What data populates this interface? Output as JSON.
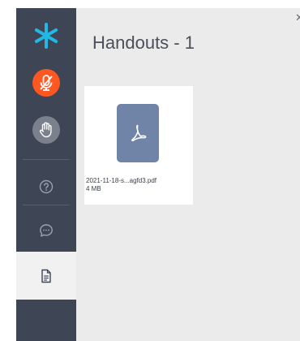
{
  "app": {
    "logo_icon": "asterisk-logo-icon",
    "accent_color": "#22b8e6",
    "mic_color": "#ff5722"
  },
  "sidebar": {
    "items": [
      {
        "name": "mute-microphone",
        "icon": "microphone-off-icon"
      },
      {
        "name": "raise-hand",
        "icon": "hand-icon"
      },
      {
        "name": "help",
        "icon": "question-circle-icon"
      },
      {
        "name": "chat",
        "icon": "chat-bubble-icon"
      },
      {
        "name": "handouts",
        "icon": "document-icon",
        "active": true
      }
    ]
  },
  "panel": {
    "title": "Handouts - 1",
    "close_icon": "close-icon",
    "files": [
      {
        "name": "2021-11-18-s...agfd3.pdf",
        "size": "4 MB",
        "icon": "pdf-icon"
      }
    ]
  }
}
